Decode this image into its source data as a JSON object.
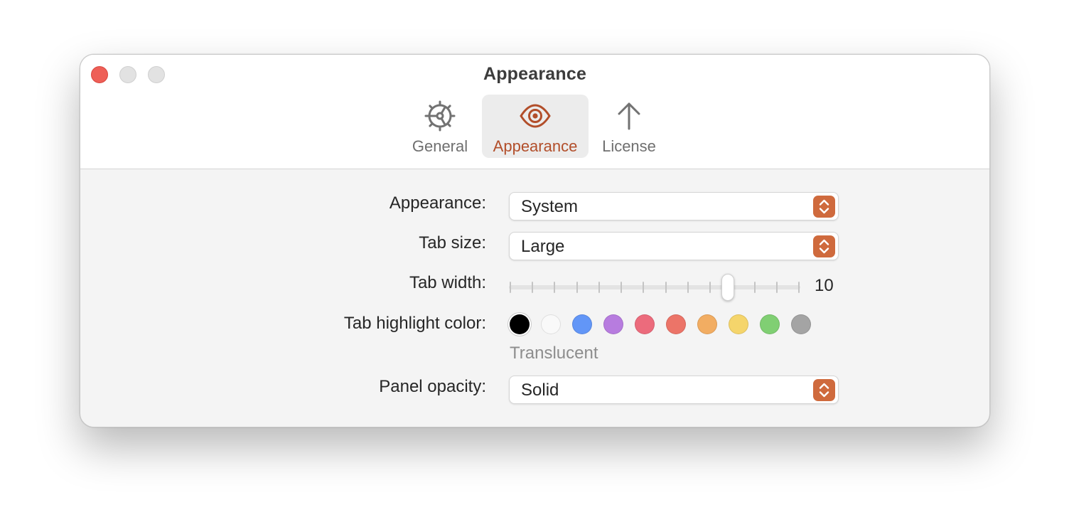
{
  "window": {
    "title": "Appearance"
  },
  "toolbar": {
    "tabs": [
      {
        "label": "General",
        "icon": "gear-icon",
        "active": false
      },
      {
        "label": "Appearance",
        "icon": "eye-icon",
        "active": true
      },
      {
        "label": "License",
        "icon": "arrow-up-icon",
        "active": false
      }
    ]
  },
  "form": {
    "appearance": {
      "label": "Appearance:",
      "value": "System"
    },
    "tab_size": {
      "label": "Tab size:",
      "value": "Large"
    },
    "tab_width": {
      "label": "Tab width:",
      "value": "10",
      "level_fraction": 0.75,
      "tick_count": 14
    },
    "highlight": {
      "label": "Tab highlight color:",
      "hint": "Translucent",
      "colors": [
        "#000000",
        "#f9f9f9",
        "#6296f7",
        "#b77cdf",
        "#ec6b7c",
        "#ec7468",
        "#f2ad62",
        "#f5d56b",
        "#80cf73",
        "#a4a4a4"
      ],
      "selected_index": 0
    },
    "panel_opacity": {
      "label": "Panel opacity:",
      "value": "Solid"
    }
  },
  "colors": {
    "accent": "#cf6a3d",
    "accent_text": "#b24e2a",
    "close": "#ee5f57"
  }
}
